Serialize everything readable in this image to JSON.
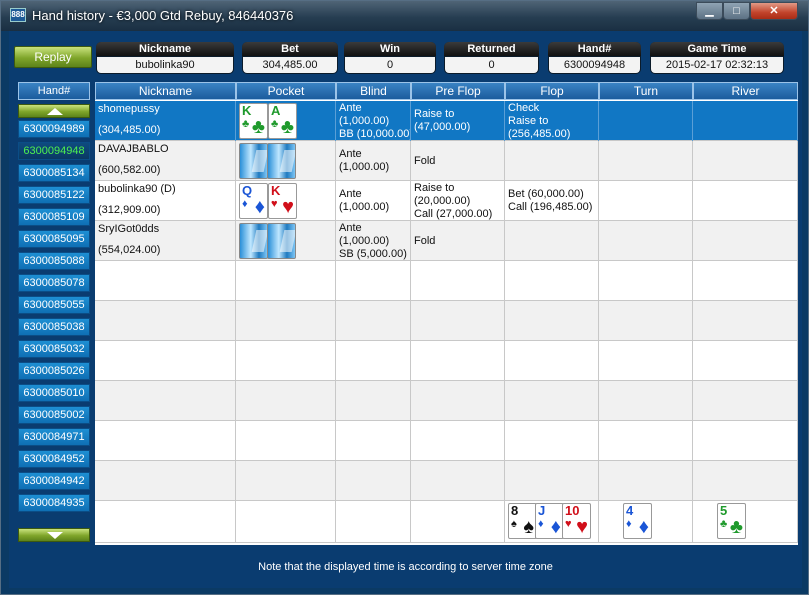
{
  "window": {
    "title": "Hand history - €3,000 Gtd Rebuy, 846440376",
    "app_icon": "888-app-icon"
  },
  "replay_label": "Replay",
  "summary": {
    "nickname_label": "Nickname",
    "nickname": "bubolinka90",
    "bet_label": "Bet",
    "bet": "304,485.00",
    "win_label": "Win",
    "win": "0",
    "returned_label": "Returned",
    "returned": "0",
    "hand_label": "Hand#",
    "hand": "6300094948",
    "time_label": "Game Time",
    "time": "2015-02-17 02:32:13"
  },
  "hand_list": {
    "header": "Hand#",
    "selected_index": 1,
    "items": [
      "6300094989",
      "6300094948",
      "6300085134",
      "6300085122",
      "6300085109",
      "6300085095",
      "6300085088",
      "6300085078",
      "6300085055",
      "6300085038",
      "6300085032",
      "6300085026",
      "6300085010",
      "6300085002",
      "6300084971",
      "6300084952",
      "6300084942",
      "6300084935"
    ]
  },
  "table": {
    "columns": [
      "Nickname",
      "Pocket",
      "Blind",
      "Pre Flop",
      "Flop",
      "Turn",
      "River"
    ],
    "players": [
      {
        "name": "shomepussy",
        "stack": "(304,485.00)",
        "blind": [
          "Ante",
          "(1,000.00)",
          "BB (10,000.00)"
        ],
        "preflop": [
          "Raise to",
          "(47,000.00)"
        ],
        "flop": [
          "Check",
          "Raise to",
          "(256,485.00)"
        ],
        "cards": [
          {
            "rank": "K",
            "suit": "♣",
            "color": "grn"
          },
          {
            "rank": "A",
            "suit": "♣",
            "color": "grn"
          }
        ]
      },
      {
        "name": "DAVAJBABLO",
        "stack": "(600,582.00)",
        "blind": [
          "Ante",
          "(1,000.00)"
        ],
        "preflop": [
          "Fold"
        ],
        "flop": [],
        "cards": "back"
      },
      {
        "name": "bubolinka90 (D)",
        "stack": "(312,909.00)",
        "blind": [
          "Ante",
          "(1,000.00)"
        ],
        "preflop": [
          "Raise to",
          "(20,000.00)",
          "Call (27,000.00)"
        ],
        "flop": [
          "Bet (60,000.00)",
          "Call (196,485.00)"
        ],
        "cards": [
          {
            "rank": "Q",
            "suit": "♦",
            "color": "blu"
          },
          {
            "rank": "K",
            "suit": "♥",
            "color": "red"
          }
        ]
      },
      {
        "name": "SryIGot0dds",
        "stack": "(554,024.00)",
        "blind": [
          "Ante",
          "(1,000.00)",
          "SB (5,000.00)"
        ],
        "preflop": [
          "Fold"
        ],
        "flop": [],
        "cards": "back"
      }
    ],
    "board": {
      "flop": [
        {
          "rank": "8",
          "suit": "♠",
          "color": "blk"
        },
        {
          "rank": "J",
          "suit": "♦",
          "color": "blu"
        },
        {
          "rank": "10",
          "suit": "♥",
          "color": "red"
        }
      ],
      "turn": [
        {
          "rank": "4",
          "suit": "♦",
          "color": "blu"
        }
      ],
      "river": [
        {
          "rank": "5",
          "suit": "♣",
          "color": "grn"
        }
      ]
    }
  },
  "footer_note": "Note that the displayed time is according to server time zone"
}
